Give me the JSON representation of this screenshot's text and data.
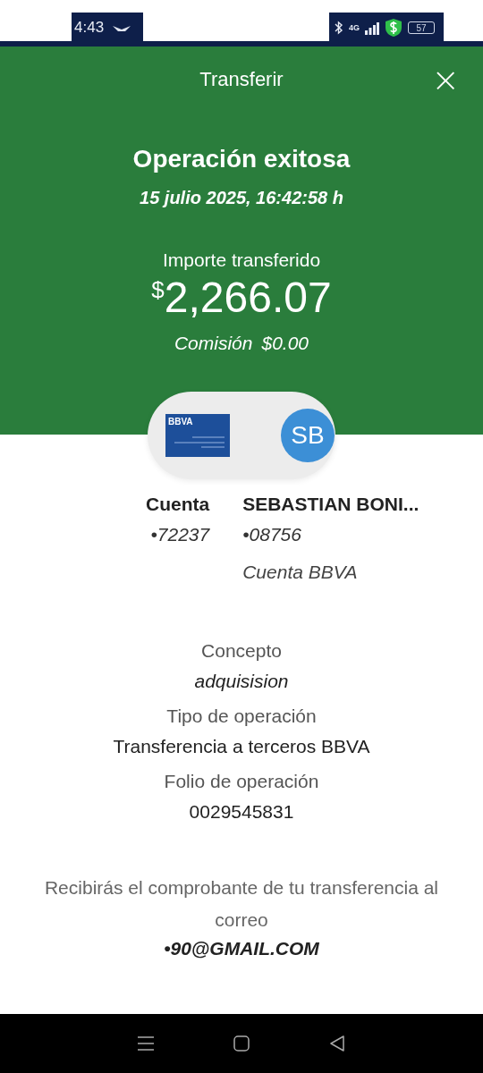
{
  "status_bar": {
    "time": "4:43",
    "network": "4G",
    "battery": "57"
  },
  "header": {
    "title": "Transferir",
    "close": "×"
  },
  "result": {
    "title": "Operación exitosa",
    "datetime": "15 julio 2025, 16:42:58 h",
    "amount_label": "Importe transferido",
    "currency": "$",
    "amount": "2,266.07",
    "fee_label": "Comisión",
    "fee": "$0.00"
  },
  "parties": {
    "avatar": "SB",
    "card_brand": "BBVA",
    "origin": {
      "name": "Cuenta",
      "number": "•72237"
    },
    "destination": {
      "name": "SEBASTIAN BONI...",
      "number": "•08756",
      "bank": "Cuenta BBVA"
    }
  },
  "details": [
    {
      "label": "Concepto",
      "value": "adquisision",
      "italic": true
    },
    {
      "label": "Tipo de operación",
      "value": "Transferencia a terceros BBVA",
      "italic": false
    },
    {
      "label": "Folio de operación",
      "value": "0029545831",
      "italic": false
    }
  ],
  "notice": {
    "text": "Recibirás el comprobante de tu transferencia al correo",
    "email": "•90@GMAIL.COM"
  }
}
